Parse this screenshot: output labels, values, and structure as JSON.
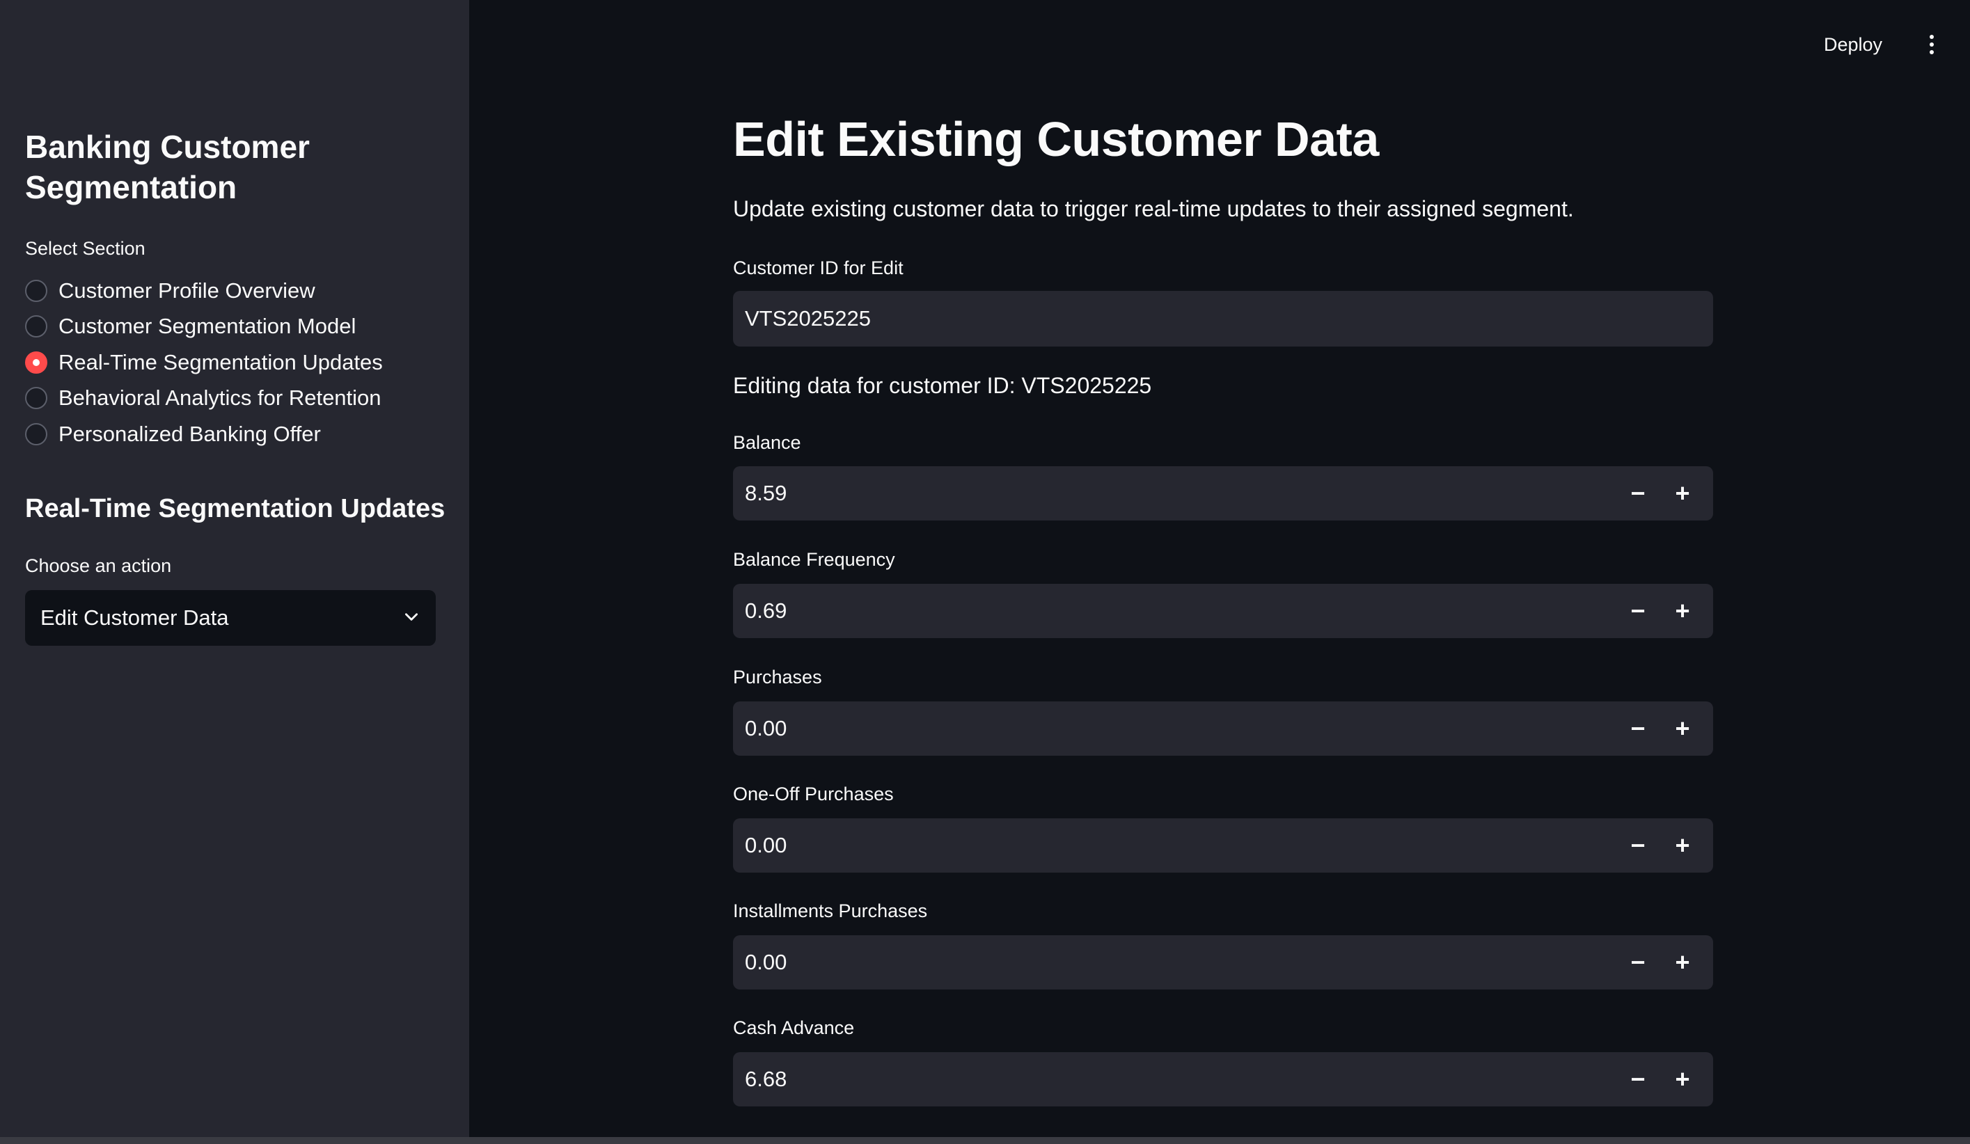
{
  "header": {
    "deploy_label": "Deploy",
    "menu_icon": "vertical-ellipsis-icon"
  },
  "sidebar": {
    "title": "Banking Customer Segmentation",
    "section_label": "Select Section",
    "sections": [
      {
        "label": "Customer Profile Overview",
        "selected": false
      },
      {
        "label": "Customer Segmentation Model",
        "selected": false
      },
      {
        "label": "Real-Time Segmentation Updates",
        "selected": true
      },
      {
        "label": "Behavioral Analytics for Retention",
        "selected": false
      },
      {
        "label": "Personalized Banking Offer",
        "selected": false
      }
    ],
    "subheader": "Real-Time Segmentation Updates",
    "action_label": "Choose an action",
    "action_value": "Edit Customer Data"
  },
  "main": {
    "title": "Edit Existing Customer Data",
    "description": "Update existing customer data to trigger real-time updates to their assigned segment.",
    "customer_id_label": "Customer ID for Edit",
    "customer_id_value": "VTS2025225",
    "editing_text": "Editing data for customer ID: VTS2025225",
    "fields": [
      {
        "label": "Balance",
        "value": "8.59"
      },
      {
        "label": "Balance Frequency",
        "value": "0.69"
      },
      {
        "label": "Purchases",
        "value": "0.00"
      },
      {
        "label": "One-Off Purchases",
        "value": "0.00"
      },
      {
        "label": "Installments Purchases",
        "value": "0.00"
      },
      {
        "label": "Cash Advance",
        "value": "6.68"
      }
    ],
    "minus_glyph": "−",
    "plus_glyph": "+"
  },
  "colors": {
    "accent": "#ff4b4b",
    "background": "#0e1117",
    "sidebar": "#262730",
    "input": "#262730"
  }
}
